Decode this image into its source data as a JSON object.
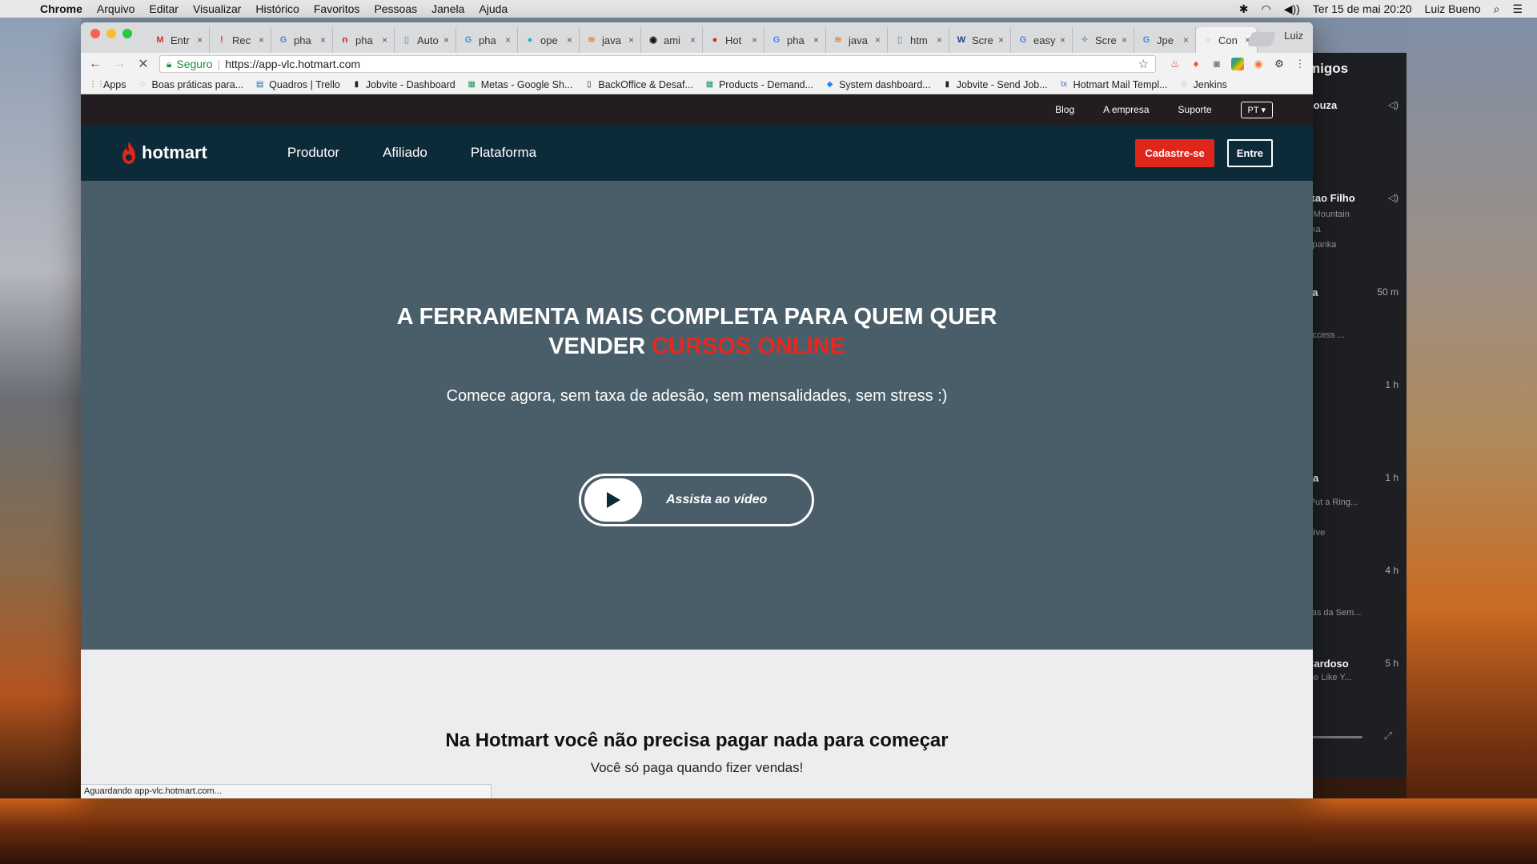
{
  "menubar": {
    "items": [
      "Chrome",
      "Arquivo",
      "Editar",
      "Visualizar",
      "Histórico",
      "Favoritos",
      "Pessoas",
      "Janela",
      "Ajuda"
    ],
    "clock": "Ter 15 de mai  20:20",
    "user": "Luiz Bueno"
  },
  "browser": {
    "tabs": [
      {
        "label": "Entr",
        "icon_color": "#d93025",
        "icon": "M"
      },
      {
        "label": "Rec",
        "icon_color": "#d93025",
        "icon": "!"
      },
      {
        "label": "pha",
        "icon_color": "#4285f4",
        "icon": "G"
      },
      {
        "label": "pha",
        "icon_color": "#c4161c",
        "icon": "n"
      },
      {
        "label": "Auto",
        "icon_color": "#9aa0a6",
        "icon": "▯"
      },
      {
        "label": "pha",
        "icon_color": "#4285f4",
        "icon": "G"
      },
      {
        "label": "ope",
        "icon_color": "#22b5c7",
        "icon": "●"
      },
      {
        "label": "java",
        "icon_color": "#f48024",
        "icon": "≋"
      },
      {
        "label": "ami",
        "icon_color": "#111",
        "icon": "◉"
      },
      {
        "label": "Hot",
        "icon_color": "#e0261b",
        "icon": "●"
      },
      {
        "label": "pha",
        "icon_color": "#4285f4",
        "icon": "G"
      },
      {
        "label": "java",
        "icon_color": "#f48024",
        "icon": "≋"
      },
      {
        "label": "htm",
        "icon_color": "#9aa0a6",
        "icon": "▯"
      },
      {
        "label": "Scre",
        "icon_color": "#1d3d8c",
        "icon": "W"
      },
      {
        "label": "easy",
        "icon_color": "#4285f4",
        "icon": "G"
      },
      {
        "label": "Scre",
        "icon_color": "#7b8fa6",
        "icon": "✧"
      },
      {
        "label": "Jpe",
        "icon_color": "#4285f4",
        "icon": "G"
      },
      {
        "label": "Con",
        "icon_color": "#1a73e8",
        "icon": "◌"
      }
    ],
    "active_tab": 17,
    "profile": "Luiz",
    "omnibox": {
      "secure_label": "Seguro",
      "url": "https://app-vlc.hotmart.com"
    },
    "bookmarks": [
      {
        "label": "Apps",
        "icon": "⋮⋮",
        "icon_color": "#555"
      },
      {
        "label": "Boas práticas para...",
        "icon": "◌",
        "icon_color": "#4285f4"
      },
      {
        "label": "Quadros | Trello",
        "icon": "▤",
        "icon_color": "#0079bf"
      },
      {
        "label": "Jobvite - Dashboard",
        "icon": "▮",
        "icon_color": "#222"
      },
      {
        "label": "Metas - Google Sh...",
        "icon": "▦",
        "icon_color": "#0f9d58"
      },
      {
        "label": "BackOffice & Desaf...",
        "icon": "▯",
        "icon_color": "#222"
      },
      {
        "label": "Products - Demand...",
        "icon": "▦",
        "icon_color": "#0f9d58"
      },
      {
        "label": "System dashboard...",
        "icon": "◆",
        "icon_color": "#2684ff"
      },
      {
        "label": "Jobvite - Send Job...",
        "icon": "▮",
        "icon_color": "#222"
      },
      {
        "label": "Hotmart Mail Templ...",
        "icon": "tx",
        "icon_color": "#3b6fb6"
      },
      {
        "label": "Jenkins",
        "icon": "☺",
        "icon_color": "#c9a37a"
      }
    ],
    "status_text": "Aguardando app-vlc.hotmart.com..."
  },
  "page": {
    "topbar": {
      "links": [
        "Blog",
        "A empresa",
        "Suporte"
      ],
      "lang": "PT"
    },
    "nav": {
      "logo": "hotmart",
      "links": [
        "Produtor",
        "Afiliado",
        "Plataforma"
      ],
      "signup": "Cadastre-se",
      "login": "Entre"
    },
    "hero": {
      "title_line1": "A FERRAMENTA MAIS COMPLETA PARA QUEM QUER",
      "title_line2_prefix": "VENDER ",
      "title_line2_accent": "CURSOS ONLINE",
      "subtitle": "Comece agora, sem taxa de adesão, sem mensalidades, sem stress :)",
      "video_button": "Assista ao vídeo"
    },
    "section": {
      "heading": "Na Hotmart você não precisa pagar nada para começar",
      "text": "Você só paga quando fizer vendas!"
    }
  },
  "side_panel": {
    "title": "migos",
    "rows": [
      {
        "name": "Souza",
        "sub": "",
        "time": ""
      },
      {
        "name": "ixao Filho",
        "sub": "y Mountain\nnka\nSpanka",
        "time": ""
      },
      {
        "name": "va",
        "sub": "Access ...",
        "time": "50 m"
      },
      {
        "name": "",
        "sub": "",
        "time": "1 h"
      },
      {
        "name": "na",
        "sub": "(Put a Ring...\n- live",
        "time": "1 h"
      },
      {
        "name": "",
        "sub": "rtas da Sem...",
        "time": "4 h"
      },
      {
        "name": "Cardoso",
        "sub": "Me Like Y...",
        "time": "5 h"
      }
    ]
  },
  "colors": {
    "brand_red": "#e0261b",
    "nav_bg": "#0d2a38",
    "hero_bg": "#4a5e69",
    "topstrip_bg": "#231c20"
  }
}
